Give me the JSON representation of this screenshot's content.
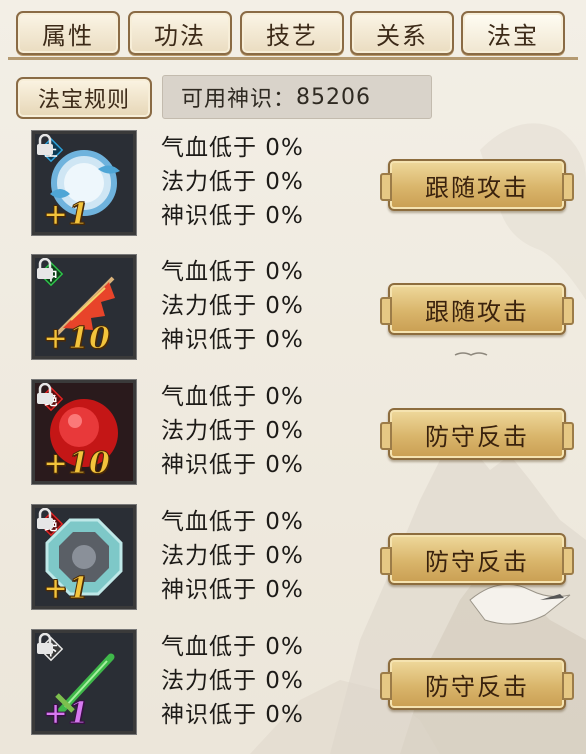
{
  "tabs": [
    {
      "label": "属性"
    },
    {
      "label": "功法"
    },
    {
      "label": "技艺"
    },
    {
      "label": "关系"
    },
    {
      "label": "法宝"
    }
  ],
  "rule_button": "法宝规则",
  "divine_sense": {
    "label": "可用神识：",
    "value": "85206"
  },
  "treasures": [
    {
      "grade": "上",
      "grade_color": "#2fa0d8",
      "icon": "mirror-treasure-icon",
      "plus": "+1",
      "plus_color": "gold",
      "stats": [
        "气血低于 0%",
        "法力低于 0%",
        "神识低于 0%"
      ],
      "action": "跟随攻击"
    },
    {
      "grade": "中",
      "grade_color": "#2ec24a",
      "icon": "flag-treasure-icon",
      "plus": "+10",
      "plus_color": "gold",
      "stats": [
        "气血低于 0%",
        "法力低于 0%",
        "神识低于 0%"
      ],
      "action": "跟随攻击"
    },
    {
      "grade": "绝",
      "grade_color": "#e02424",
      "icon": "red-gem-treasure-icon",
      "plus": "+10",
      "plus_color": "gold",
      "stats": [
        "气血低于 0%",
        "法力低于 0%",
        "神识低于 0%"
      ],
      "action": "防守反击"
    },
    {
      "grade": "绝",
      "grade_color": "#e02424",
      "icon": "octagon-mirror-treasure-icon",
      "plus": "+1",
      "plus_color": "gold",
      "stats": [
        "气血低于 0%",
        "法力低于 0%",
        "神识低于 0%"
      ],
      "action": "防守反击"
    },
    {
      "grade": "下",
      "grade_color": "#e8e8e8",
      "icon": "green-sword-treasure-icon",
      "plus": "+1",
      "plus_color": "purple",
      "stats": [
        "气血低于 0%",
        "法力低于 0%",
        "神识低于 0%"
      ],
      "action": "防守反击"
    }
  ]
}
